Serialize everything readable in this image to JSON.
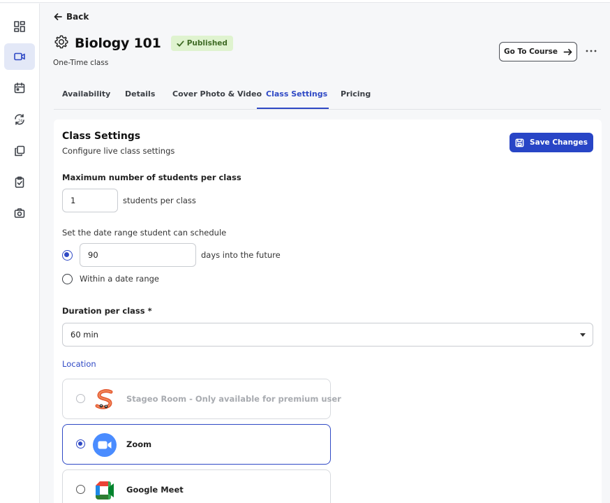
{
  "colors": {
    "accent": "#2f49c5",
    "save_button": "#2845c6",
    "badge_bg": "#dff3cf",
    "badge_text": "#3f6b25",
    "zoom": "#4a8cff"
  },
  "sidebar": {
    "items": [
      {
        "icon": "dashboard-icon",
        "active": false
      },
      {
        "icon": "video-camera-icon",
        "active": true
      },
      {
        "icon": "calendar-icon",
        "active": false
      },
      {
        "icon": "recurring-24-icon",
        "active": false
      },
      {
        "icon": "copy-icon",
        "active": false
      },
      {
        "icon": "clipboard-check-icon",
        "active": false
      },
      {
        "icon": "camera-icon",
        "active": false
      }
    ]
  },
  "header": {
    "back_label": "Back",
    "title": "Biology 101",
    "status_badge": "Published",
    "subtitle": "One-Time class",
    "goto_label": "Go To Course"
  },
  "tabs": [
    {
      "label": "Availability",
      "active": false
    },
    {
      "label": "Details",
      "active": false
    },
    {
      "label": "Cover Photo & Video",
      "active": false
    },
    {
      "label": "Class Settings",
      "active": true
    },
    {
      "label": "Pricing",
      "active": false
    }
  ],
  "settings": {
    "title": "Class Settings",
    "subtitle": "Configure live class settings",
    "save_label": "Save Changes",
    "max_students": {
      "label": "Maximum number of students per class",
      "value": "1",
      "suffix": "students per class"
    },
    "date_range": {
      "label": "Set the date range student can schedule",
      "options": [
        {
          "selected": true,
          "value": "90",
          "suffix": "days into the future"
        },
        {
          "selected": false,
          "label": "Within a date range"
        }
      ]
    },
    "duration": {
      "label": "Duration per class *",
      "value": "60 min"
    },
    "location": {
      "label": "Location",
      "options": [
        {
          "label": "Stageo Room - Only available for premium user",
          "selected": false,
          "disabled": true,
          "icon": "stageo-logo"
        },
        {
          "label": "Zoom",
          "selected": true,
          "disabled": false,
          "icon": "zoom-logo"
        },
        {
          "label": "Google Meet",
          "selected": false,
          "disabled": false,
          "icon": "google-meet-logo"
        }
      ]
    }
  }
}
